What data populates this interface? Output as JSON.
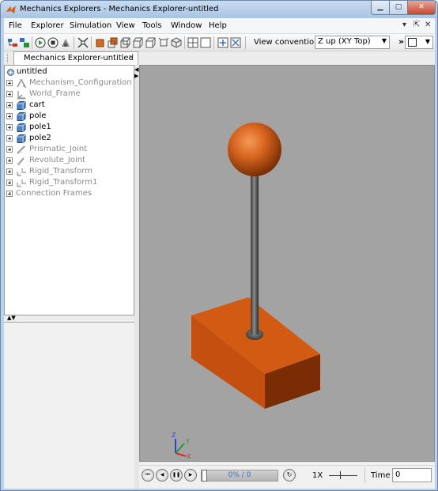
{
  "window": {
    "title": "Mechanics Explorers - Mechanics Explorer-untitled"
  },
  "menubar": {
    "items": [
      "File",
      "Explorer",
      "Simulation",
      "View",
      "Tools",
      "Window",
      "Help"
    ],
    "right_controls": [
      "▾",
      "⇱",
      "✕"
    ]
  },
  "toolbar": {
    "view_convention_label": "View convention:",
    "view_convention_value": "Z up (XY Top)",
    "overflow": "»"
  },
  "tab": {
    "label": "Mechanics Explorer-untitled",
    "close": "✕"
  },
  "tree": {
    "root": "untitled",
    "items": [
      {
        "label": "Mechanism_Configuration",
        "icon": "configuration-icon",
        "dimmed": true
      },
      {
        "label": "World_Frame",
        "icon": "frame-icon",
        "dimmed": true
      },
      {
        "label": "cart",
        "icon": "solid-icon",
        "dimmed": false
      },
      {
        "label": "pole",
        "icon": "solid-icon",
        "dimmed": false
      },
      {
        "label": "pole1",
        "icon": "solid-icon",
        "dimmed": false
      },
      {
        "label": "pole2",
        "icon": "solid-icon",
        "dimmed": false
      },
      {
        "label": "Prismatic_Joint",
        "icon": "joint-icon",
        "dimmed": true
      },
      {
        "label": "Revolute_Joint",
        "icon": "joint-icon",
        "dimmed": true
      },
      {
        "label": "Rigid_Transform",
        "icon": "transform-icon",
        "dimmed": true
      },
      {
        "label": "Rigid_Transform1",
        "icon": "transform-icon",
        "dimmed": true
      },
      {
        "label": "Connection Frames",
        "icon": "",
        "dimmed": true
      }
    ]
  },
  "viewport": {
    "background_color": "#a3a3a3",
    "body_color": "#c8500f",
    "triad": {
      "x": "X",
      "y": "Y",
      "z": "Z"
    }
  },
  "playback": {
    "progress_text": "0% / 0",
    "progress_fraction": 0,
    "speed_label": "1X",
    "time_label": "Time",
    "time_value": "0"
  }
}
